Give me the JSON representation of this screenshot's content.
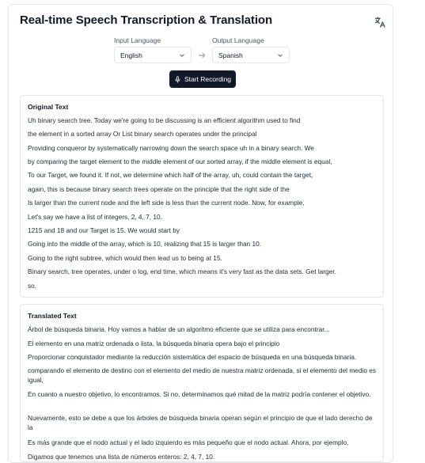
{
  "header": {
    "title": "Real-time Speech Transcription & Translation",
    "translate_icon": "translate-icon"
  },
  "languages": {
    "input_label": "Input Language",
    "input_value": "English",
    "output_label": "Output Language",
    "output_value": "Spanish"
  },
  "record_button": {
    "label": "Start Recording",
    "icon": "microphone-icon"
  },
  "original": {
    "heading": "Original Text",
    "lines": [
      "Uh binary search tree. Today we're going to be discussing is an efficient algorithm used to find",
      "the element in a sorted array Or List binary search operates under the principal",
      "Providing conqueror by systematically narrowing down the search space uh in a binary search. We",
      "by comparing the target element to the middle element of our sorted array, if the middle element is equal,",
      "To our Target, we found it. If not, we determine which half of the array, uh, could contain the target,",
      "again, this is because binary search trees operate on the principle that the right side of the",
      "Is larger than the current node and the left side is less than the current node. Now, for example,",
      "Let's say we have a list of integers, 2, 4, 7, 10.",
      "1215 and 18 and our Target is 15. We would start by",
      "Going into the middle of the array, which is 10, realizing that 15 is larger than 10.",
      "Going to the right subtree, which would then lead us to being at 15.",
      "Binary search, tree operates, under o log, end time, which means it's very fast as the data sets. Get larger.",
      "so,"
    ]
  },
  "translated": {
    "heading": "Translated Text",
    "lines": [
      "Árbol de búsqueda binaria. Hoy vamos a hablar de un algoritmo eficiente que se utiliza para encontrar...",
      "El elemento en una matriz ordenada o lista, la búsqueda binaria opera bajo el principio",
      "Proporcionar conquistador mediante la reducción sistemática del espacio de búsqueda en una búsqueda binaria.",
      "comparando el elemento de destino con el elemento del medio de nuestra matriz ordenada, si el elemento del medio es igual,",
      "En cuanto a nuestro objetivo, lo encontramos. Si no, determinamos qué mitad de la matriz podría contener el objetivo.",
      "Nuevamente, esto se debe a que los árboles de búsqueda binaria operan según el principio de que el lado derecho de la",
      "Es más grande que el nodo actual y el lado izquierdo es más pequeño que el nodo actual. Ahora, por ejemplo,",
      "Digamos que tenemos una lista de números enteros: 2, 4, 7, 10."
    ]
  },
  "colors": {
    "primary": "#111827",
    "border": "#e5e7eb",
    "muted": "#4b5563"
  }
}
